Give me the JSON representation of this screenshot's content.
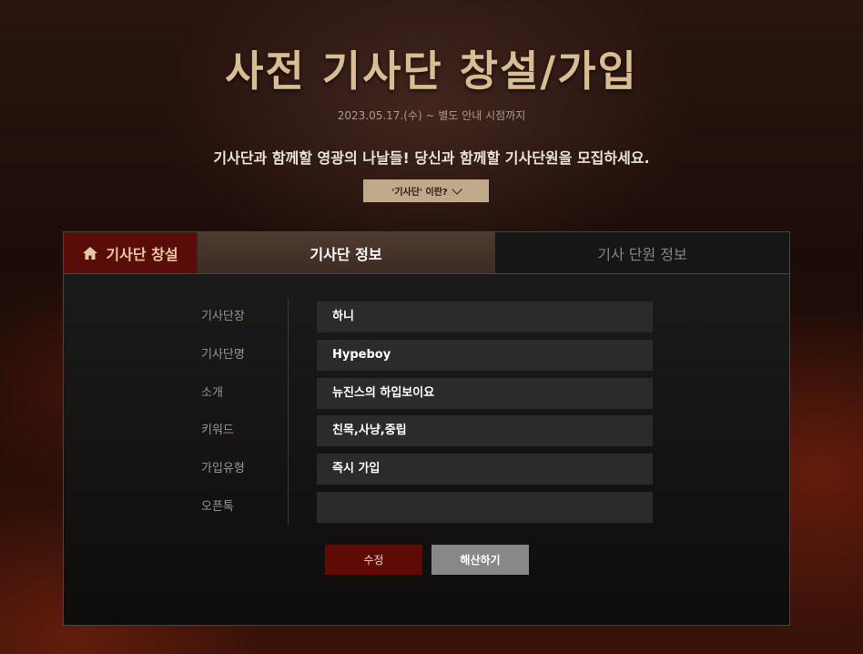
{
  "header": {
    "title": "사전 기사단 창설/가입",
    "period": "2023.05.17.(수) ~ 별도 안내 시점까지",
    "headline": "기사단과 함께할 영광의 나날들! 당신과 함께할 기사단원을 모집하세요.",
    "what_button": "'기사단' 이란?"
  },
  "tabs": {
    "create": "기사단 창설",
    "info": "기사단 정보",
    "member": "기사 단원 정보"
  },
  "form": {
    "rows": [
      {
        "label": "기사단장",
        "value": "하니"
      },
      {
        "label": "기사단명",
        "value": "Hypeboy"
      },
      {
        "label": "소개",
        "value": "뉴진스의 하입보이요"
      },
      {
        "label": "키워드",
        "value": "친목,사냥,중립"
      },
      {
        "label": "가입유형",
        "value": "즉시 가입"
      },
      {
        "label": "오픈톡",
        "value": ""
      }
    ]
  },
  "buttons": {
    "edit": "수정",
    "disband": "해산하기"
  },
  "colors": {
    "title": "#d8bd94",
    "accent_red": "#5e0a06",
    "tab_active": "#4e3a30"
  }
}
